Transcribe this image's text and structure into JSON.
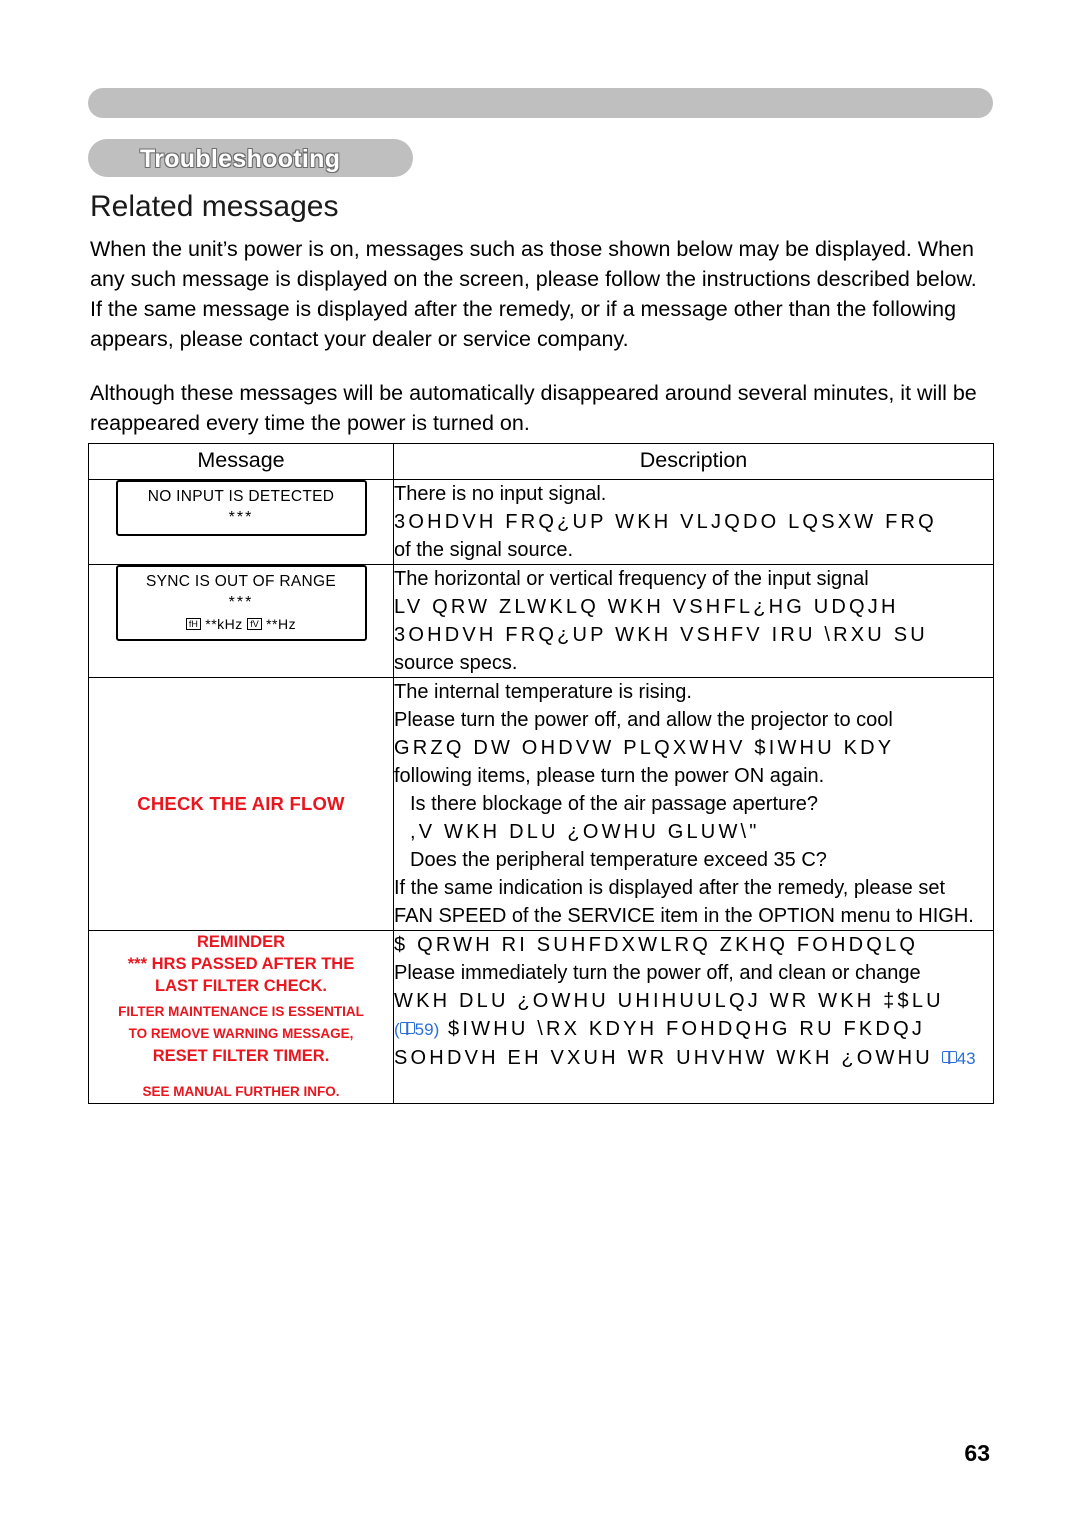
{
  "header": {
    "running_head": "Troubleshooting",
    "chapter_tab": "Troubleshooting"
  },
  "section": {
    "title": "Related messages",
    "paragraph1": "When the unit’s power is on, messages such as those shown below may be displayed. When any such message is displayed on the screen, please follow the instructions described below. If the same message is displayed after the remedy, or if a message other than the following appears, please contact your dealer or service company.",
    "paragraph2": "Although these messages will be automatically disappeared around several minutes, it will be reappeared every time the power is turned on."
  },
  "table": {
    "headers": {
      "message": "Message",
      "description": "Description"
    },
    "rows": [
      {
        "message": {
          "type": "osd",
          "line1": "NO INPUT IS DETECTED",
          "line2": "***"
        },
        "description": [
          "There is no input signal.",
          "3OHDVH FRQ¿UP WKH VLJQDO LQSXW FRQ",
          "of the signal source."
        ]
      },
      {
        "message": {
          "type": "osd",
          "line1": "SYNC IS OUT OF RANGE",
          "line2": "***",
          "line3_h_label": "fH",
          "line3_h_value": "**kHz",
          "line3_v_label": "fV",
          "line3_v_value": "**Hz"
        },
        "description": [
          "The horizontal or vertical frequency of the input signal",
          "LV QRW ZLWKLQ WKH VSHFL¿HG UDQJH",
          "3OHDVH FRQ¿UP WKH VSHFV IRU \\RXU SU",
          "source specs."
        ]
      },
      {
        "message": {
          "type": "red",
          "text": "CHECK THE AIR FLOW"
        },
        "description": [
          "The internal temperature is rising.",
          "Please turn the power off, and allow the projector to cool",
          "GRZQ DW OHDVW  PLQXWHV $IWHU KDY",
          "following items, please turn the power ON again.",
          "Is there blockage of the air passage aperture?",
          ",V WKH DLU ¿OWHU GLUW\\\"",
          "Does the peripheral temperature exceed 35 C?",
          "If the same indication is displayed after the remedy, please set",
          "FAN SPEED of the SERVICE item in the OPTION menu to HIGH."
        ]
      },
      {
        "message": {
          "type": "red-multiline",
          "lines": [
            "REMINDER",
            "*** HRS PASSED AFTER THE",
            "LAST FILTER CHECK.",
            "FILTER MAINTENANCE IS ESSENTIAL",
            "TO REMOVE WARNING MESSAGE,",
            "RESET FILTER TIMER.",
            "SEE MANUAL FURTHER INFO."
          ]
        },
        "description": [
          "$ QRWH RI SUHFDXWLRQ ZKHQ FOHDQLQ",
          "Please immediately turn the power off, and clean or change",
          "WKH DLU ¿OWHU UHIHUULQJ WR WKH ‡$LU",
          "$IWHU \\RX KDYH FOHDQHG RU FKDQJ",
          "SOHDVH EH VXUH WR UHVHW WKH ¿OWHU"
        ],
        "page_refs": [
          "59",
          "43"
        ]
      }
    ]
  },
  "footer": {
    "page_number": "63"
  }
}
